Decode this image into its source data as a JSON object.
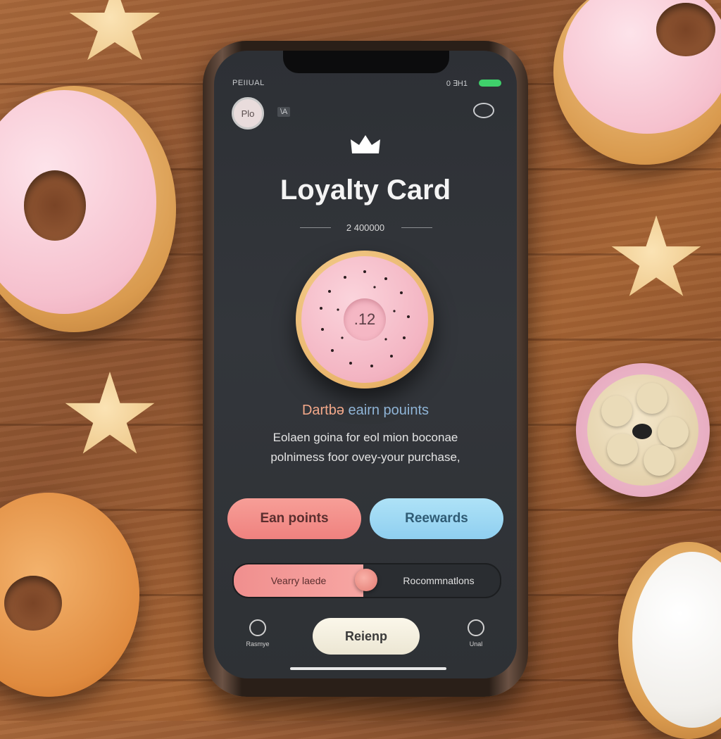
{
  "status_bar": {
    "carrier": "PEIIUAL",
    "right_text": "0  ∃H1"
  },
  "header": {
    "avatar_text": "Plo",
    "chip_text": "\\A"
  },
  "card": {
    "title": "Loyalty Card",
    "points_total": "2 400000",
    "stamp_count": ".12"
  },
  "earn": {
    "heading_pre": "Dartbə",
    "heading_main": "eairn pouints",
    "description_line1": "Eolaen goina for eol mion boconae",
    "description_line2": "polnimess foor ovey-your purchase,"
  },
  "buttons": {
    "earn_label": "Ean points",
    "rewards_label": "Reewards"
  },
  "segment": {
    "left_label": "Vearry laede",
    "right_label": "Rocommnatlons"
  },
  "bottom_nav": {
    "left_label": "Rasmye",
    "center_label": "Reienp",
    "right_label": "Unal"
  },
  "colors": {
    "accent_pink": "#ef827f",
    "accent_blue": "#8fcff0",
    "screen_bg": "#2d3035",
    "battery": "#3fd06b"
  }
}
